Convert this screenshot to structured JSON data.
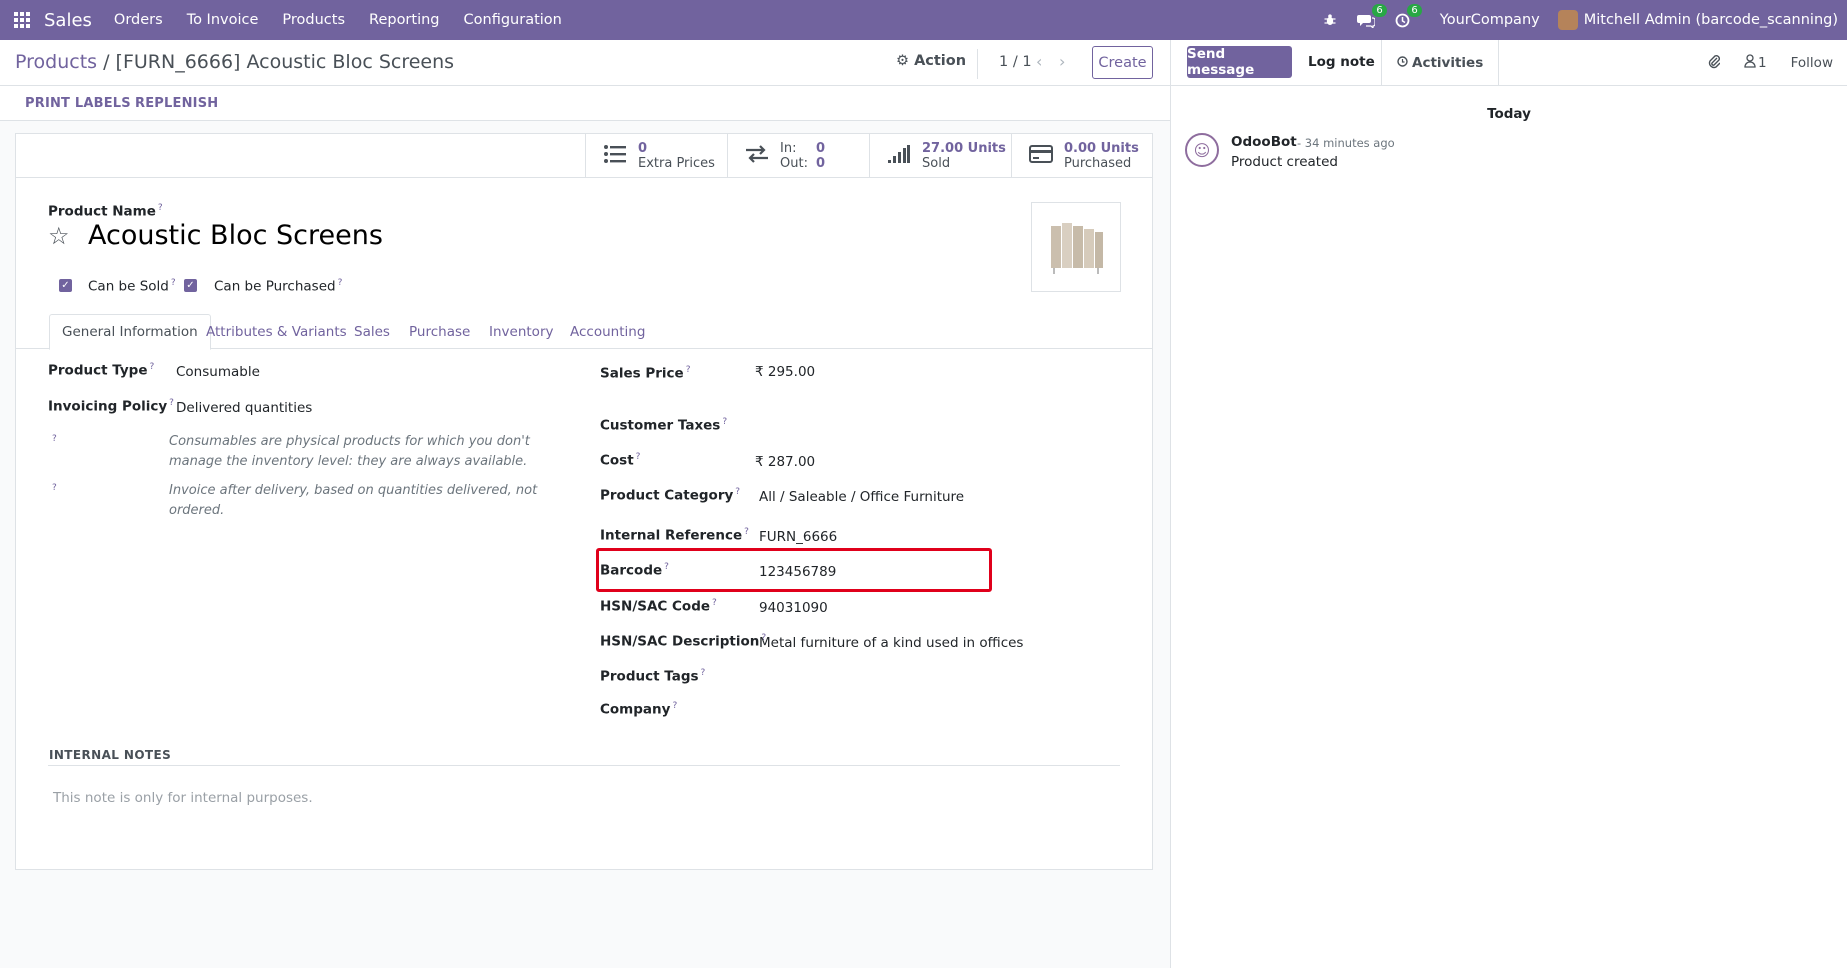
{
  "navbar": {
    "app_name": "Sales",
    "menu": [
      "Orders",
      "To Invoice",
      "Products",
      "Reporting",
      "Configuration"
    ],
    "messages_count": "6",
    "activities_count": "6",
    "company": "YourCompany",
    "user": "Mitchell Admin (barcode_scanning)"
  },
  "control": {
    "breadcrumb_parent": "Products",
    "breadcrumb_sep": " / ",
    "breadcrumb_current": "[FURN_6666] Acoustic Bloc Screens",
    "action_label": "Action",
    "pager": "1 / 1",
    "create_label": "Create"
  },
  "statusbar": {
    "print_labels": "PRINT LABELS",
    "replenish": "REPLENISH"
  },
  "smart_buttons": {
    "extra_prices_value": "0",
    "extra_prices_label": "Extra Prices",
    "in_label": "In:",
    "in_value": "0",
    "out_label": "Out:",
    "out_value": "0",
    "sold_value": "27.00 Units",
    "sold_label": "Sold",
    "purchased_value": "0.00 Units",
    "purchased_label": "Purchased"
  },
  "product": {
    "name_label": "Product Name",
    "name": "Acoustic Bloc Screens",
    "can_be_sold": "Can be Sold",
    "can_be_purchased": "Can be Purchased"
  },
  "tabs": [
    "General Information",
    "Attributes & Variants",
    "Sales",
    "Purchase",
    "Inventory",
    "Accounting"
  ],
  "general": {
    "product_type_label": "Product Type",
    "product_type": "Consumable",
    "invoicing_policy_label": "Invoicing Policy",
    "invoicing_policy": "Delivered quantities",
    "help_type": "Consumables are physical products for which you don't manage the inventory level: they are always available.",
    "help_invoice": "Invoice after delivery, based on quantities delivered, not ordered.",
    "sales_price_label": "Sales Price",
    "sales_price": "₹ 295.00",
    "customer_taxes_label": "Customer Taxes",
    "cost_label": "Cost",
    "cost": "₹ 287.00",
    "category_label": "Product Category",
    "category": "All / Saleable / Office Furniture",
    "internal_ref_label": "Internal Reference",
    "internal_ref": "FURN_6666",
    "barcode_label": "Barcode",
    "barcode": "123456789",
    "hsn_code_label": "HSN/SAC Code",
    "hsn_code": "94031090",
    "hsn_desc_label": "HSN/SAC Description",
    "hsn_desc": "Metal furniture of a kind used in offices",
    "tags_label": "Product Tags",
    "company_label": "Company"
  },
  "notes": {
    "title": "INTERNAL NOTES",
    "placeholder": "This note is only for internal purposes."
  },
  "chatter": {
    "send_message": "Send message",
    "log_note": "Log note",
    "activities": "Activities",
    "followers_count": "1",
    "follow": "Follow",
    "today": "Today",
    "author": "OdooBot",
    "time": "- 34 minutes ago",
    "message": "Product created"
  },
  "colors": {
    "brand": "#71639e",
    "badge": "#28a745",
    "highlight": "#e0001b"
  }
}
